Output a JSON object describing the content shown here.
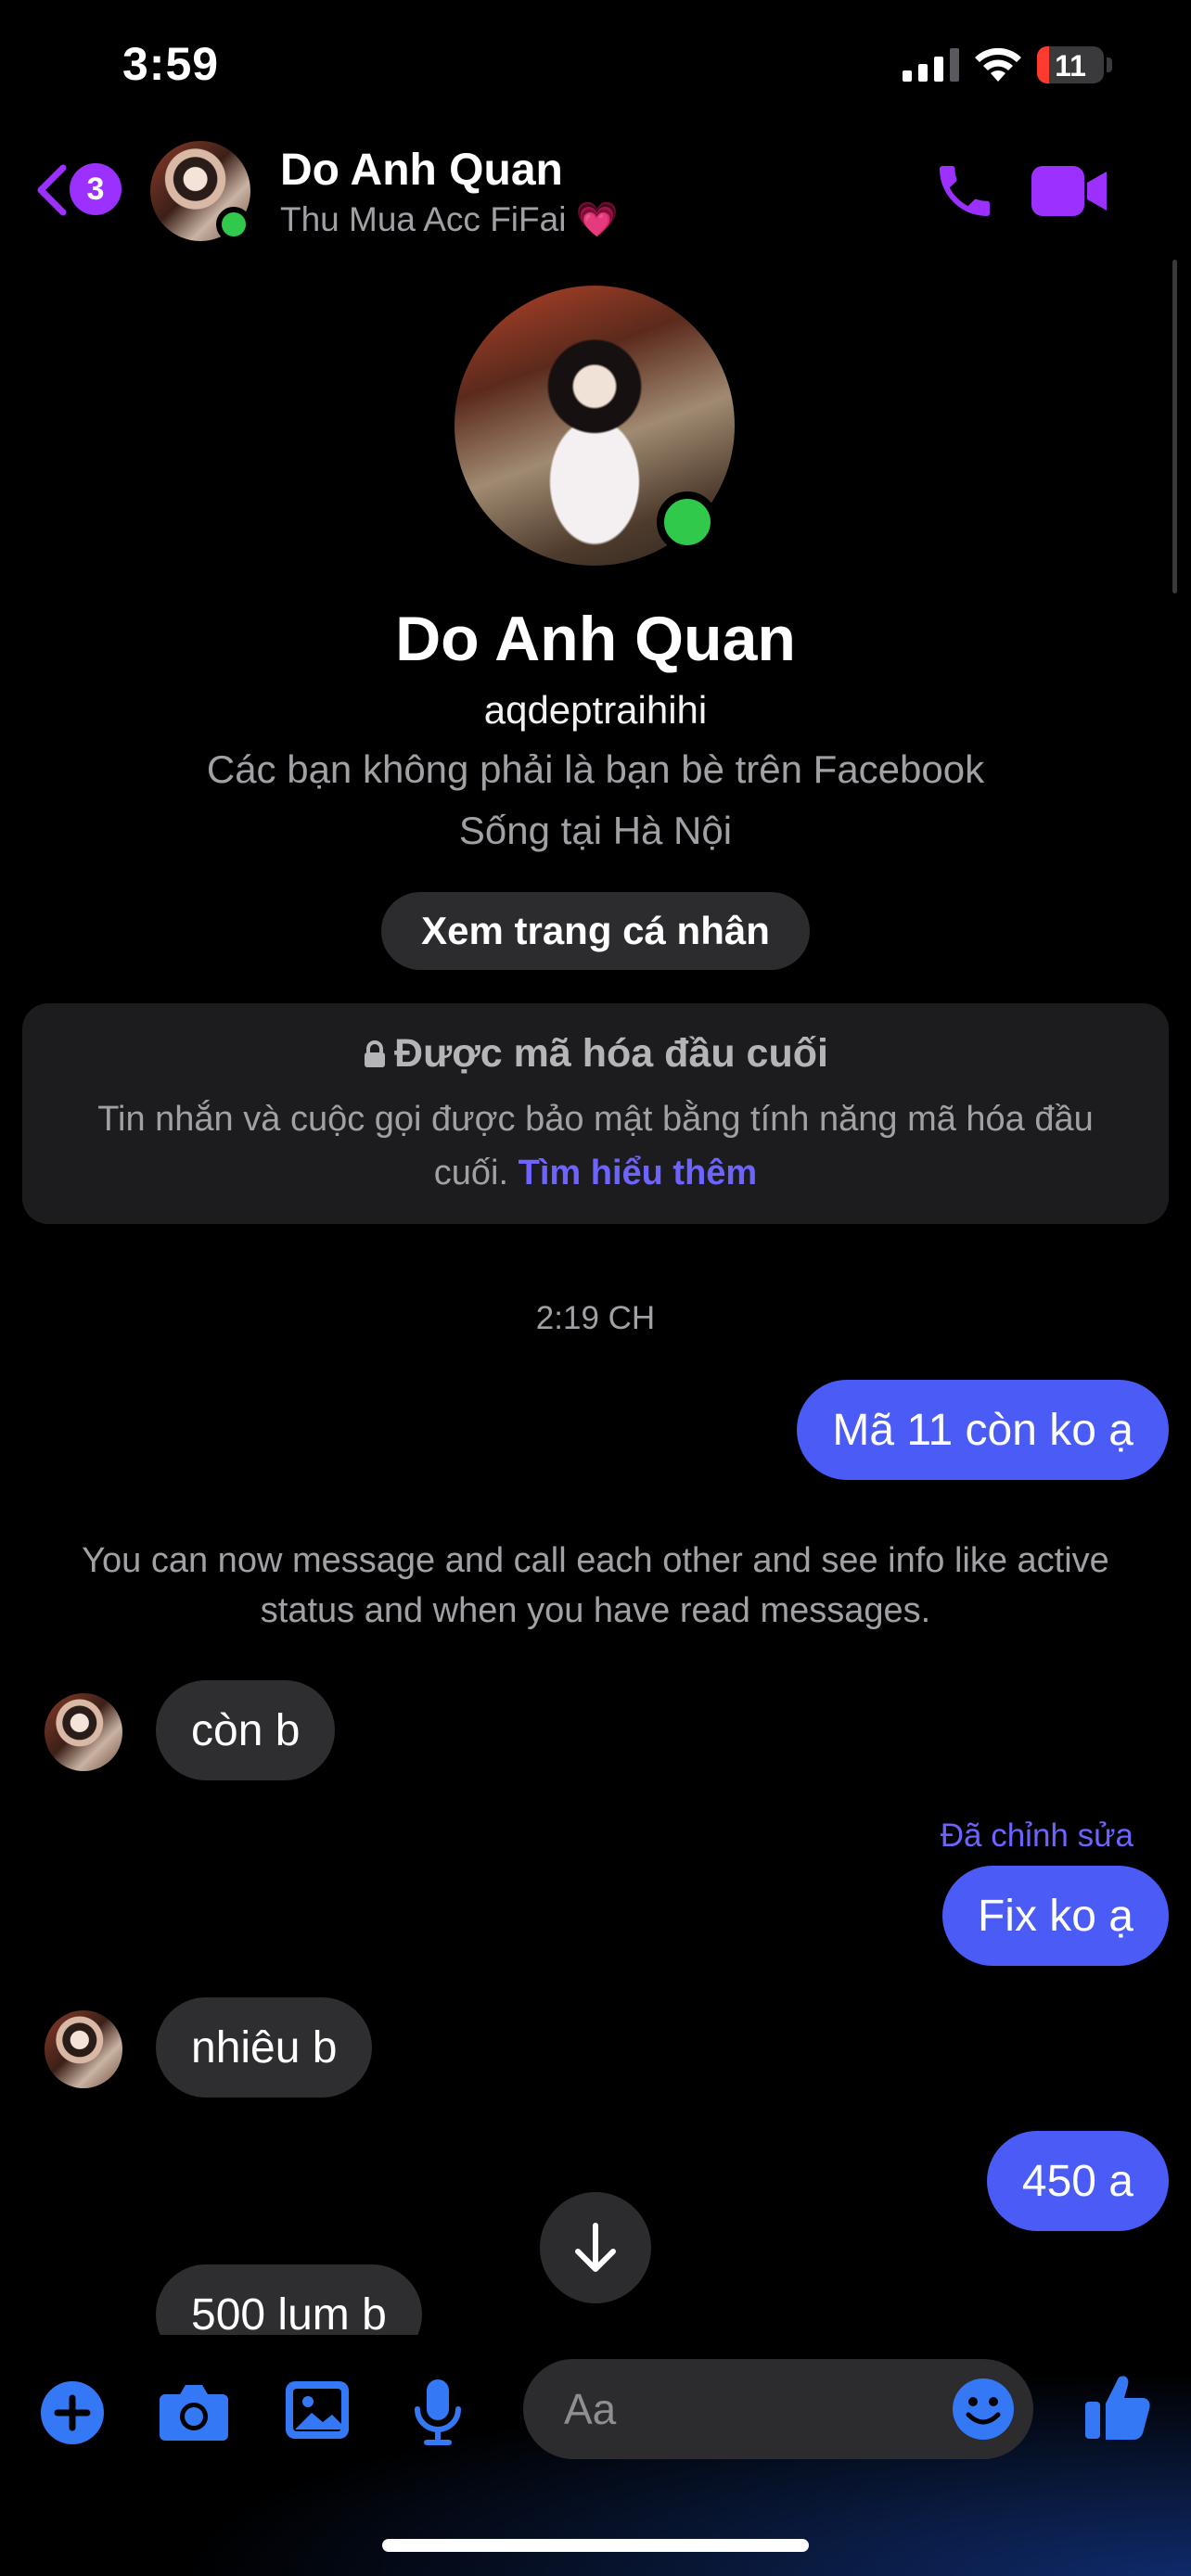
{
  "status_bar": {
    "time": "3:59",
    "battery": "11"
  },
  "header": {
    "unread_count": "3",
    "name": "Do Anh Quan",
    "subtitle": "Thu Mua Acc FiFai 💗"
  },
  "profile": {
    "name": "Do Anh Quan",
    "username": "aqdeptraihihi",
    "friend_note": "Các bạn không phải là bạn bè trên Facebook",
    "lives_in": "Sống tại Hà Nội",
    "view_profile_label": "Xem trang cá nhân"
  },
  "encryption": {
    "title": "Được mã hóa đầu cuối",
    "body": "Tin nhắn và cuộc gọi được bảo mật bằng tính năng mã hóa đầu cuối.",
    "link": "Tìm hiểu thêm"
  },
  "conversation": {
    "timestamp": "2:19 CH",
    "system_note": "You can now message and call each other and see info like active status and when you have read messages.",
    "edited_label": "Đã chỉnh sửa",
    "messages": [
      {
        "from": "me",
        "text": "Mã 11 còn ko ạ"
      },
      {
        "from": "them",
        "text": "còn b"
      },
      {
        "from": "me",
        "text": "Fix ko ạ"
      },
      {
        "from": "them",
        "text": "nhiêu b"
      },
      {
        "from": "me",
        "text": "450 a"
      },
      {
        "from": "them",
        "text": "500 lum b"
      }
    ]
  },
  "composer": {
    "placeholder": "Aa"
  },
  "colors": {
    "accent": "#9b30ff",
    "outgoing_bubble": "#4a5cf5",
    "incoming_bubble": "#2e2e30",
    "link": "#6d63ff",
    "online": "#31c94c",
    "composer_icons": "#3478f6"
  },
  "icons": [
    "back-chevron-icon",
    "phone-icon",
    "video-camera-icon",
    "lock-icon",
    "arrow-down-icon",
    "plus-icon",
    "camera-icon",
    "image-icon",
    "microphone-icon",
    "emoji-icon",
    "thumbs-up-icon"
  ]
}
